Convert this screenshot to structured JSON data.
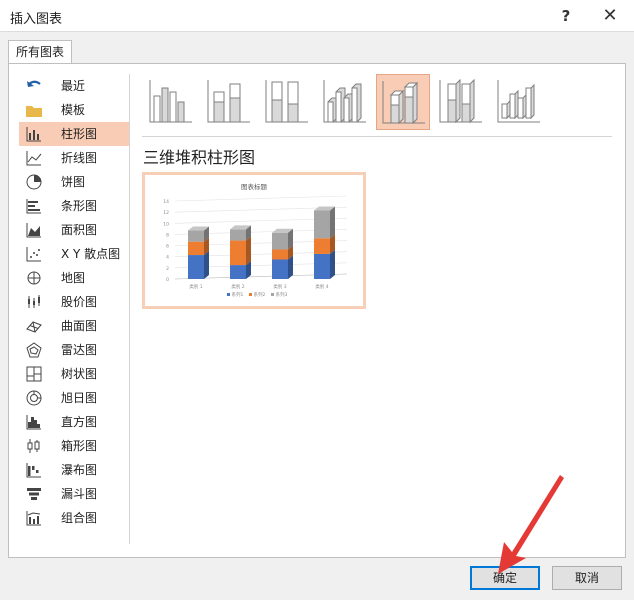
{
  "window": {
    "title": "插入图表",
    "help_label": "?",
    "close_label": "✕"
  },
  "tabs": [
    {
      "label": "所有图表"
    }
  ],
  "sidebar": {
    "items": [
      {
        "label": "最近",
        "icon": "undo-arrow-icon"
      },
      {
        "label": "模板",
        "icon": "folder-icon"
      },
      {
        "label": "柱形图",
        "icon": "column-chart-icon",
        "selected": true
      },
      {
        "label": "折线图",
        "icon": "line-chart-icon"
      },
      {
        "label": "饼图",
        "icon": "pie-chart-icon"
      },
      {
        "label": "条形图",
        "icon": "bar-chart-icon"
      },
      {
        "label": "面积图",
        "icon": "area-chart-icon"
      },
      {
        "label": "X Y 散点图",
        "icon": "scatter-chart-icon"
      },
      {
        "label": "地图",
        "icon": "map-chart-icon"
      },
      {
        "label": "股价图",
        "icon": "stock-chart-icon"
      },
      {
        "label": "曲面图",
        "icon": "surface-chart-icon"
      },
      {
        "label": "雷达图",
        "icon": "radar-chart-icon"
      },
      {
        "label": "树状图",
        "icon": "treemap-chart-icon"
      },
      {
        "label": "旭日图",
        "icon": "sunburst-chart-icon"
      },
      {
        "label": "直方图",
        "icon": "histogram-chart-icon"
      },
      {
        "label": "箱形图",
        "icon": "box-whisker-chart-icon"
      },
      {
        "label": "瀑布图",
        "icon": "waterfall-chart-icon"
      },
      {
        "label": "漏斗图",
        "icon": "funnel-chart-icon"
      },
      {
        "label": "组合图",
        "icon": "combo-chart-icon"
      }
    ]
  },
  "chart_types": [
    {
      "name": "clustered-column-icon"
    },
    {
      "name": "stacked-column-icon"
    },
    {
      "name": "percent-stacked-column-icon"
    },
    {
      "name": "3d-clustered-column-icon"
    },
    {
      "name": "3d-stacked-column-icon",
      "selected": true
    },
    {
      "name": "3d-percent-stacked-column-icon"
    },
    {
      "name": "3d-column-icon"
    }
  ],
  "selected_chart_name": "三维堆积柱形图",
  "chart_data": {
    "type": "bar",
    "title": "图表标题",
    "categories": [
      "类别 1",
      "类别 2",
      "类别 3",
      "类别 4"
    ],
    "series": [
      {
        "name": "系列1",
        "color": "#4472c4",
        "values": [
          4.3,
          2.5,
          3.5,
          4.5
        ]
      },
      {
        "name": "系列2",
        "color": "#ed7d31",
        "values": [
          2.4,
          4.4,
          1.8,
          2.8
        ]
      },
      {
        "name": "系列3",
        "color": "#a5a5a5",
        "values": [
          2,
          2,
          3,
          5
        ]
      }
    ],
    "ylim": [
      0,
      14
    ],
    "yticks": [
      0,
      2,
      4,
      6,
      8,
      10,
      12,
      14
    ],
    "grid": true,
    "legend": "bottom"
  },
  "buttons": {
    "ok_label": "确定",
    "cancel_label": "取消"
  },
  "colors": {
    "selected_bg": "#f9cdb5",
    "accent": "#0078d7",
    "annotation_arrow": "#e53935"
  }
}
